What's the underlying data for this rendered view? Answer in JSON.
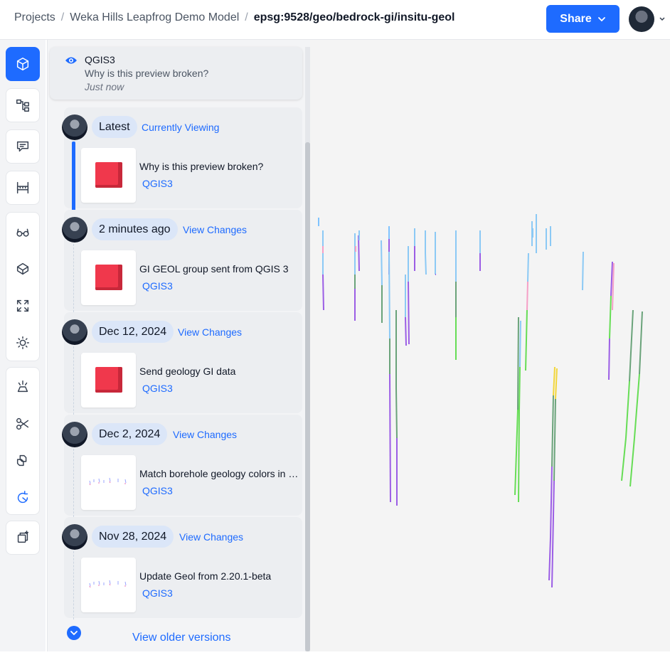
{
  "breadcrumb": {
    "root": "Projects",
    "project": "Weka Hills Leapfrog Demo Model",
    "model": "epsg:9528/geo/bedrock-gi/insitu-geol"
  },
  "header": {
    "share_label": "Share"
  },
  "rail": {
    "tools": [
      "cube-icon",
      "model-tree-icon",
      "comments-icon",
      "measure-icon",
      "glasses-icon",
      "projection-icon",
      "fit-view-icon",
      "lighting-icon",
      "explode-icon",
      "section-icon",
      "filter-icon",
      "sync-icon",
      "new-view-icon"
    ]
  },
  "comment": {
    "author": "QGIS3",
    "text": "Why is this preview broken?",
    "time": "Just now"
  },
  "versions": [
    {
      "label": "Latest",
      "link": "Currently Viewing",
      "message": "Why is this preview broken?",
      "source": "QGIS3",
      "thumb": "red-cube"
    },
    {
      "label": "2 minutes ago",
      "link": "View Changes",
      "message": "GI GEOL group sent from QGIS 3",
      "source": "QGIS3",
      "thumb": "red-cube"
    },
    {
      "label": "Dec 12, 2024",
      "link": "View Changes",
      "message": "Send geology GI data",
      "source": "QGIS3",
      "thumb": "red-cube"
    },
    {
      "label": "Dec 2, 2024",
      "link": "View Changes",
      "message": "Match borehole geology colors in QGIS",
      "source": "QGIS3",
      "thumb": "boreholes"
    },
    {
      "label": "Nov 28, 2024",
      "link": "View Changes",
      "message": "Update Geol from 2.20.1-beta",
      "source": "QGIS3",
      "thumb": "boreholes"
    }
  ],
  "older_versions_label": "View older versions",
  "colors": {
    "accent": "#1e6bff",
    "pill": "#dbe6f8",
    "panel_bg": "#f3f4f6"
  }
}
